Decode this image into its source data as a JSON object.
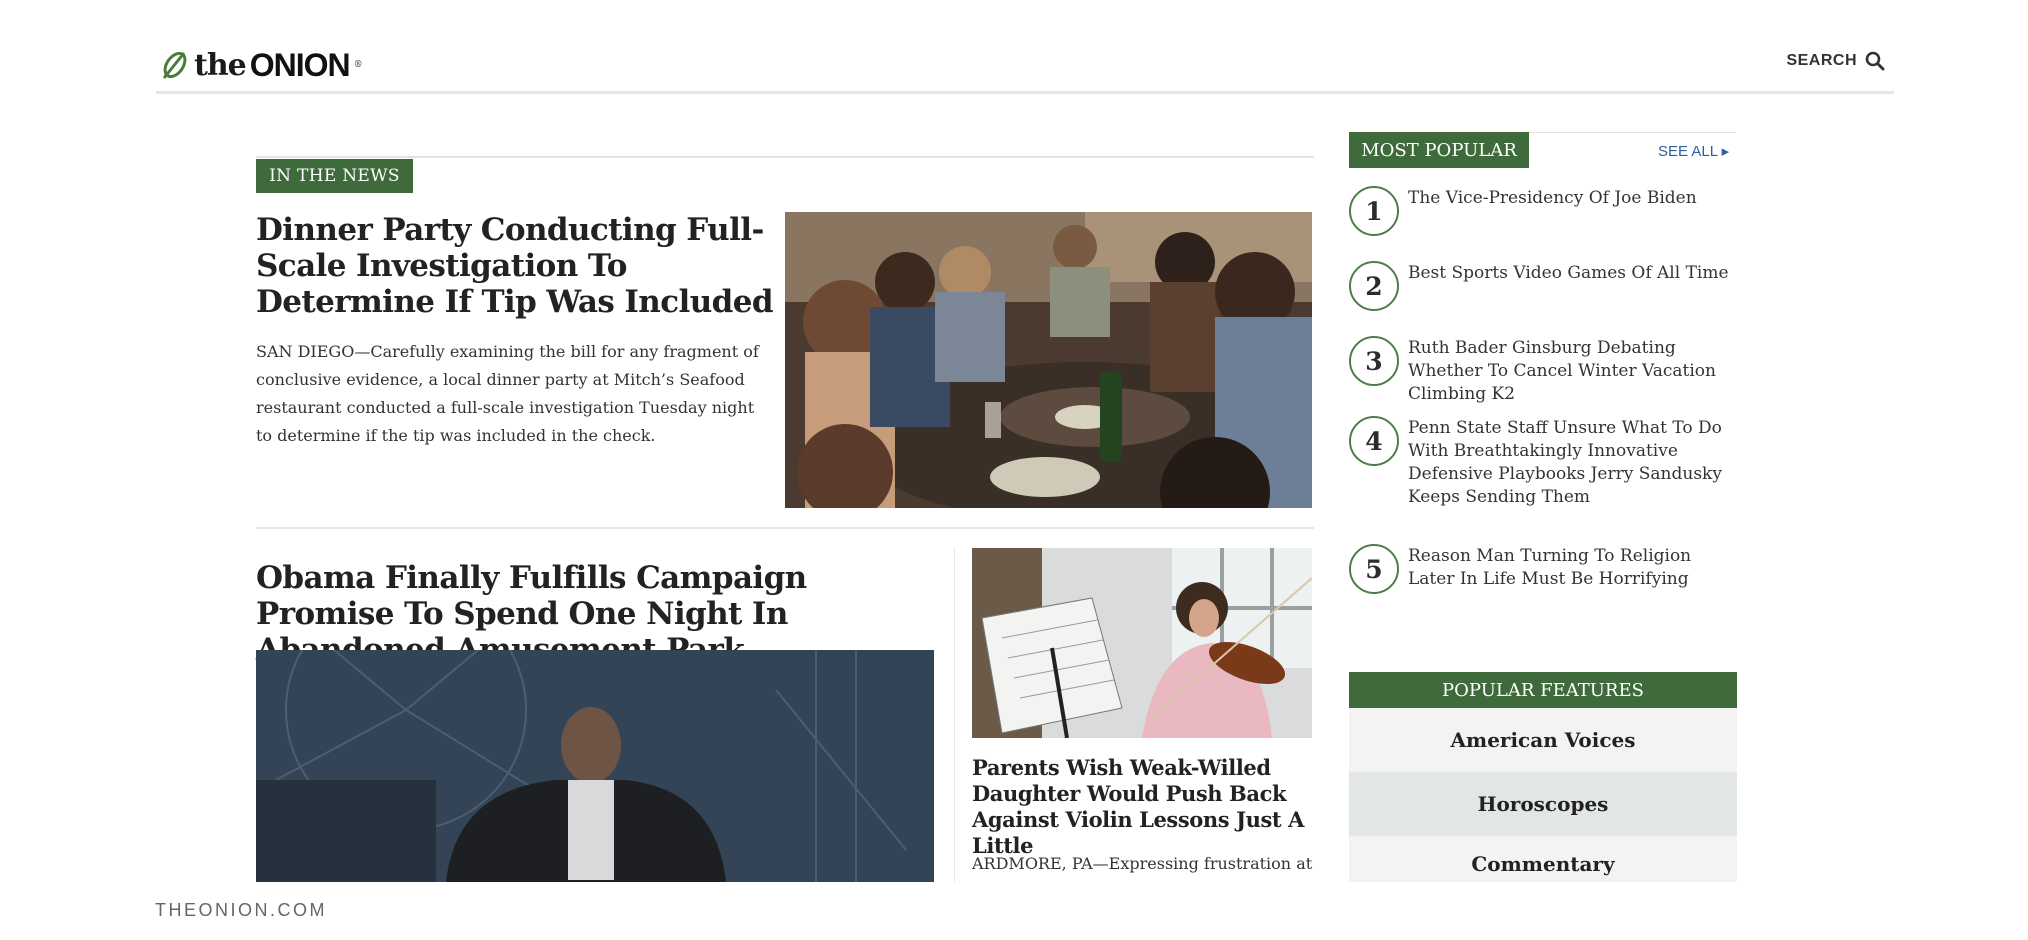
{
  "header": {
    "logo": {
      "the": "the",
      "onion": "ONION",
      "reg": "®"
    },
    "search_label": "SEARCH"
  },
  "main": {
    "section_tag": "IN THE NEWS",
    "lead": {
      "title": "Dinner Party Conducting Full-Scale Investigation To Determine If Tip Was Included",
      "body": "SAN DIEGO—Carefully examining the bill for any fragment of conclusive evidence, a local dinner party at Mitch’s Seafood restaurant conducted a full-scale investigation Tuesday night to determine if the tip was included in the check."
    },
    "secondary": {
      "title": "Obama Finally Fulfills Campaign Promise To Spend One Night In Abandoned Amusement Park"
    },
    "side_story": {
      "title": "Parents Wish Weak-Willed Daughter Would Push Back Against Violin Lessons Just A Little",
      "body": "ARDMORE, PA—Expressing frustration at"
    }
  },
  "sidebar": {
    "most_popular_label": "MOST POPULAR",
    "see_all_label": "SEE ALL ▸",
    "items": [
      {
        "num": "1",
        "title": "The Vice-Presidency Of Joe Biden"
      },
      {
        "num": "2",
        "title": "Best Sports Video Games Of All Time"
      },
      {
        "num": "3",
        "title": "Ruth Bader Ginsburg Debating Whether To Cancel Winter Vacation Climbing K2"
      },
      {
        "num": "4",
        "title": "Penn State Staff Unsure What To Do With Breathtakingly Innovative Defensive Playbooks Jerry Sandusky Keeps Sending Them"
      },
      {
        "num": "5",
        "title": "Reason Man Turning To Religion Later In Life Must Be Horrifying"
      }
    ],
    "features_label": "POPULAR FEATURES",
    "features": [
      "American Voices",
      "Horoscopes",
      "Commentary"
    ]
  },
  "footer": {
    "caption": "THEONION.COM"
  },
  "colors": {
    "brand_green": "#3f6b3c",
    "link_blue": "#2f5f9b"
  }
}
